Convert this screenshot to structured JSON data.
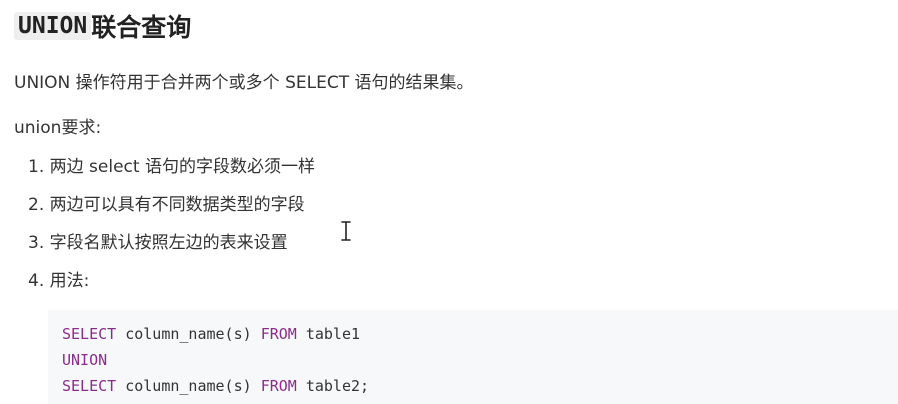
{
  "heading": {
    "code": "UNION",
    "text": "联合查询"
  },
  "intro": "UNION 操作符用于合并两个或多个 SELECT 语句的结果集。",
  "requirements_label": "union要求:",
  "requirements": [
    "1. 两边 select 语句的字段数必须一样",
    "2. 两边可以具有不同数据类型的字段",
    "3. 字段名默认按照左边的表来设置",
    "4. 用法:"
  ],
  "code": {
    "line1": {
      "kw1": "SELECT",
      "mid": " column_name(s) ",
      "kw2": "FROM",
      "tail": " table1"
    },
    "line2": {
      "kw1": "UNION"
    },
    "line3": {
      "kw1": "SELECT",
      "mid": " column_name(s) ",
      "kw2": "FROM",
      "tail": " table2;"
    }
  },
  "colors": {
    "keyword": "#8a2c8c",
    "code_background": "#f6f8fa",
    "text": "#333333"
  },
  "icons": {
    "cursor": "text-cursor-icon"
  }
}
